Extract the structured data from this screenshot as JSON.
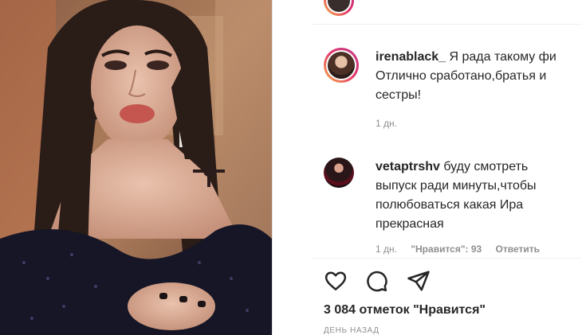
{
  "post": {
    "image_alt": "Woman with long dark hair in sequined off-shoulder dress"
  },
  "comments": [
    {
      "username": "irenablack_",
      "text": " Я рада такому фи",
      "text_line2": "Отлично сработано,братья и",
      "text_line3": "сестры!",
      "time": "1 дн."
    },
    {
      "username": "vetaptrshv",
      "text": " буду смотреть",
      "text_line2": "выпуск ради минуты,чтобы",
      "text_line3": "полюбоваться какая Ира",
      "text_line4": "прекрасная",
      "time": "1 дн.",
      "likes_label": "\"Нравится\": 93",
      "reply_label": "Ответить"
    }
  ],
  "actions": {
    "like_icon": "heart-icon",
    "comment_icon": "comment-icon",
    "share_icon": "paper-plane-icon"
  },
  "likes_text": "3 084 отметок \"Нравится\"",
  "time_ago": "день назад"
}
